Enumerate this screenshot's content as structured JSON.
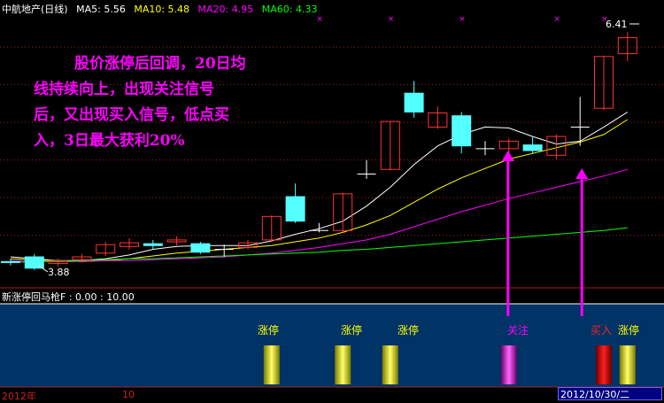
{
  "header": {
    "stock": "中航地产(日线)",
    "ma5": {
      "label": "MA5:",
      "value": "5.56",
      "color": "#ffffff"
    },
    "ma10": {
      "label": "MA10:",
      "value": "5.48",
      "color": "#ffff00"
    },
    "ma20": {
      "label": "MA20:",
      "value": "4.95",
      "color": "#ff00ff"
    },
    "ma60": {
      "label": "MA60:",
      "value": "4.33",
      "color": "#00ff00"
    }
  },
  "annotation": {
    "line1": "股价涨停后回调，20日均",
    "line2": "线持续向上，出现关注信号",
    "line3": "后，又出现买入信号，低点买",
    "line4": "入，3日最大获利20%"
  },
  "price_labels": {
    "high": "6.41",
    "low": "3.88"
  },
  "indicator": {
    "title": "新涨停回马枪F  : 0.00 : 10.00",
    "signals": [
      {
        "label": "涨停",
        "type": "limit_up",
        "color": "#ffff00"
      },
      {
        "label": "涨停",
        "type": "limit_up",
        "color": "#ffff00"
      },
      {
        "label": "涨停",
        "type": "limit_up",
        "color": "#ffff00"
      },
      {
        "label": "关注",
        "type": "watch",
        "color": "#ff00ff"
      },
      {
        "label": "买入",
        "type": "buy",
        "color": "#ff2020"
      },
      {
        "label": "涨停",
        "type": "limit_up",
        "color": "#ffff00"
      }
    ]
  },
  "bottom": {
    "year": "2012年",
    "month": "10",
    "date": "2012/10/30/二"
  },
  "chart_data": {
    "type": "candlestick",
    "ylim": [
      3.7,
      6.6
    ],
    "candles": [
      {
        "o": 3.97,
        "c": 3.96,
        "h": 4.0,
        "l": 3.93
      },
      {
        "o": 4.02,
        "c": 3.9,
        "h": 4.05,
        "l": 3.88
      },
      {
        "o": 3.95,
        "c": 3.98,
        "h": 4.0,
        "l": 3.92
      },
      {
        "o": 3.99,
        "c": 4.02,
        "h": 4.05,
        "l": 3.96
      },
      {
        "o": 4.06,
        "c": 4.15,
        "h": 4.18,
        "l": 4.03
      },
      {
        "o": 4.13,
        "c": 4.17,
        "h": 4.22,
        "l": 4.1
      },
      {
        "o": 4.16,
        "c": 4.14,
        "h": 4.2,
        "l": 4.1
      },
      {
        "o": 4.18,
        "c": 4.2,
        "h": 4.24,
        "l": 4.14
      },
      {
        "o": 4.16,
        "c": 4.07,
        "h": 4.18,
        "l": 4.05
      },
      {
        "o": 4.1,
        "c": 4.1,
        "h": 4.15,
        "l": 4.02
      },
      {
        "o": 4.12,
        "c": 4.17,
        "h": 4.2,
        "l": 4.1
      },
      {
        "o": 4.2,
        "c": 4.45,
        "h": 4.46,
        "l": 4.18
      },
      {
        "o": 4.66,
        "c": 4.4,
        "h": 4.8,
        "l": 4.38
      },
      {
        "o": 4.3,
        "c": 4.3,
        "h": 4.38,
        "l": 4.28
      },
      {
        "o": 4.3,
        "c": 4.69,
        "h": 4.7,
        "l": 4.28
      },
      {
        "o": 4.9,
        "c": 4.9,
        "h": 5.05,
        "l": 4.85
      },
      {
        "o": 4.95,
        "c": 5.46,
        "h": 5.46,
        "l": 4.94
      },
      {
        "o": 5.76,
        "c": 5.56,
        "h": 5.89,
        "l": 5.5
      },
      {
        "o": 5.4,
        "c": 5.55,
        "h": 5.62,
        "l": 5.38
      },
      {
        "o": 5.52,
        "c": 5.2,
        "h": 5.56,
        "l": 5.12
      },
      {
        "o": 5.17,
        "c": 5.17,
        "h": 5.25,
        "l": 5.1
      },
      {
        "o": 5.17,
        "c": 5.25,
        "h": 5.28,
        "l": 5.12
      },
      {
        "o": 5.21,
        "c": 5.15,
        "h": 5.3,
        "l": 5.12
      },
      {
        "o": 5.1,
        "c": 5.3,
        "h": 5.32,
        "l": 5.06
      },
      {
        "o": 5.4,
        "c": 5.4,
        "h": 5.72,
        "l": 5.2
      },
      {
        "o": 5.6,
        "c": 6.15,
        "h": 6.16,
        "l": 5.58
      },
      {
        "o": 6.18,
        "c": 6.35,
        "h": 6.41,
        "l": 6.1
      }
    ],
    "ma": [
      {
        "name": "MA5",
        "color": "#ffffff",
        "values": [
          4.02,
          4.0,
          3.98,
          3.98,
          4.0,
          4.04,
          4.1,
          4.13,
          4.14,
          4.14,
          4.14,
          4.19,
          4.26,
          4.32,
          4.4,
          4.56,
          4.76,
          5.0,
          5.2,
          5.32,
          5.4,
          5.39,
          5.3,
          5.22,
          5.25,
          5.4,
          5.56
        ]
      },
      {
        "name": "MA10",
        "color": "#ffff00",
        "values": [
          4.0,
          3.99,
          3.98,
          3.97,
          3.98,
          4.0,
          4.03,
          4.06,
          4.08,
          4.1,
          4.12,
          4.14,
          4.18,
          4.22,
          4.28,
          4.36,
          4.46,
          4.6,
          4.74,
          4.86,
          4.96,
          5.06,
          5.12,
          5.18,
          5.24,
          5.32,
          5.48
        ]
      },
      {
        "name": "MA20",
        "color": "#ff00ff",
        "values": [
          3.98,
          3.97,
          3.97,
          3.97,
          3.98,
          3.98,
          3.99,
          4.0,
          4.01,
          4.02,
          4.04,
          4.06,
          4.09,
          4.12,
          4.16,
          4.2,
          4.26,
          4.34,
          4.42,
          4.5,
          4.57,
          4.64,
          4.7,
          4.76,
          4.82,
          4.88,
          4.95
        ]
      },
      {
        "name": "MA60",
        "color": "#00ff00",
        "values": [
          3.96,
          3.97,
          3.97,
          3.98,
          3.99,
          4.0,
          4.0,
          4.01,
          4.02,
          4.03,
          4.04,
          4.05,
          4.06,
          4.07,
          4.09,
          4.1,
          4.12,
          4.14,
          4.16,
          4.18,
          4.2,
          4.22,
          4.24,
          4.26,
          4.28,
          4.3,
          4.33
        ]
      }
    ],
    "indicator_bars": [
      {
        "index": 11,
        "type": "limit_up"
      },
      {
        "index": 14,
        "type": "limit_up"
      },
      {
        "index": 16,
        "type": "limit_up"
      },
      {
        "index": 21,
        "type": "watch"
      },
      {
        "index": 25,
        "type": "buy"
      },
      {
        "index": 26,
        "type": "limit_up"
      }
    ]
  }
}
